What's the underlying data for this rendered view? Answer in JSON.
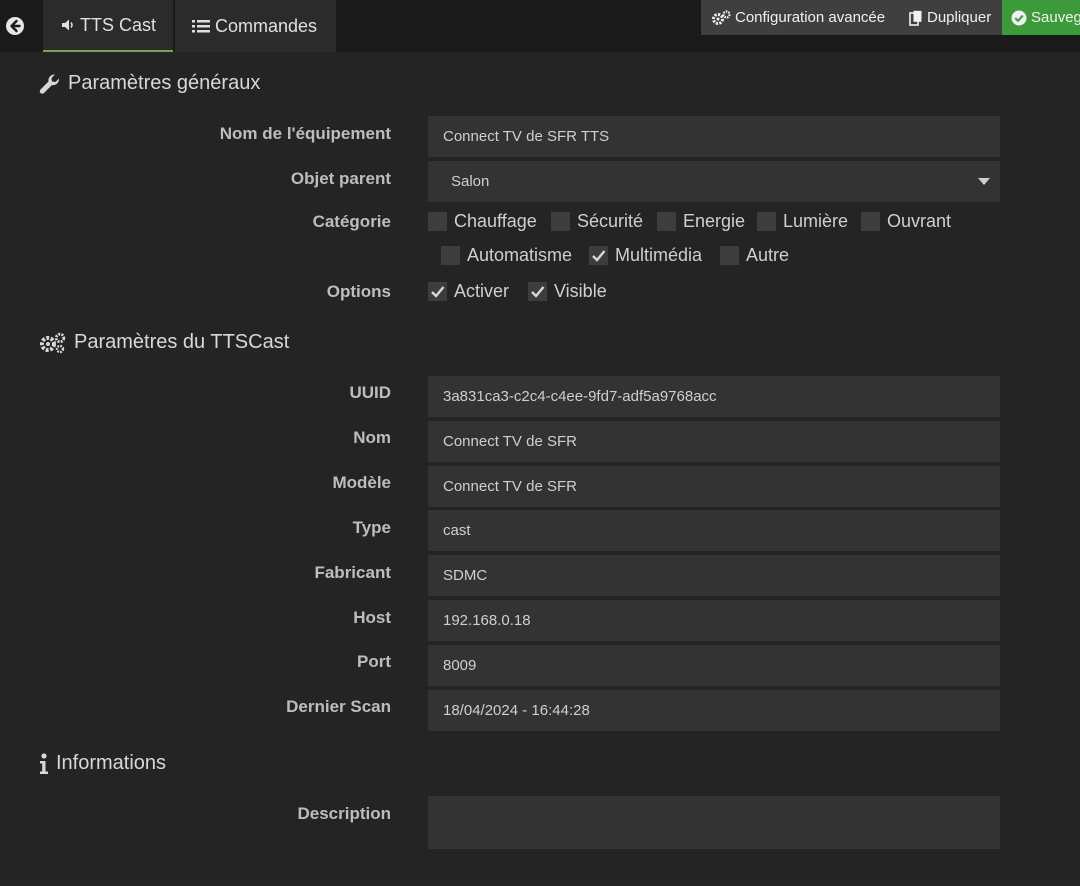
{
  "topbar": {
    "tabs": [
      {
        "label": "TTS Cast"
      },
      {
        "label": "Commandes"
      }
    ],
    "actions": {
      "config": "Configuration avancée",
      "duplicate": "Dupliquer",
      "save": "Sauvegarder"
    }
  },
  "general": {
    "title": "Paramètres généraux",
    "name_label": "Nom de l'équipement",
    "name_value": "Connect TV de SFR TTS",
    "parent_label": "Objet parent",
    "parent_value": "Salon",
    "category_label": "Catégorie",
    "categories": [
      {
        "label": "Chauffage",
        "checked": false
      },
      {
        "label": "Sécurité",
        "checked": false
      },
      {
        "label": "Energie",
        "checked": false
      },
      {
        "label": "Lumière",
        "checked": false
      },
      {
        "label": "Ouvrant",
        "checked": false
      },
      {
        "label": "Automatisme",
        "checked": false
      },
      {
        "label": "Multimédia",
        "checked": true
      },
      {
        "label": "Autre",
        "checked": false
      }
    ],
    "options_label": "Options",
    "options": [
      {
        "label": "Activer",
        "checked": true
      },
      {
        "label": "Visible",
        "checked": true
      }
    ]
  },
  "ttscast": {
    "title": "Paramètres du TTSCast",
    "fields": [
      {
        "label": "UUID",
        "value": "3a831ca3-c2c4-c4ee-9fd7-adf5a9768acc"
      },
      {
        "label": "Nom",
        "value": "Connect TV de SFR"
      },
      {
        "label": "Modèle",
        "value": "Connect TV de SFR"
      },
      {
        "label": "Type",
        "value": "cast"
      },
      {
        "label": "Fabricant",
        "value": "SDMC"
      },
      {
        "label": "Host",
        "value": "192.168.0.18"
      },
      {
        "label": "Port",
        "value": "8009"
      },
      {
        "label": "Dernier Scan",
        "value": "18/04/2024 - 16:44:28"
      }
    ]
  },
  "info": {
    "title": "Informations",
    "description_label": "Description",
    "description_value": ""
  },
  "colors": {
    "background": "#242424",
    "topbar": "#1a1a1a",
    "field": "#333333",
    "save": "#3c9a3a",
    "active_tab_underline": "#7d9e4f"
  }
}
